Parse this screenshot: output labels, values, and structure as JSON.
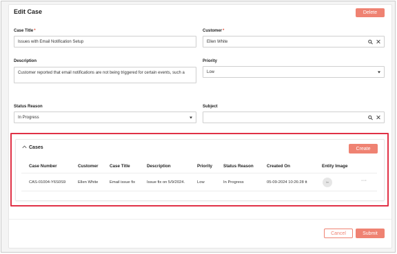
{
  "header": {
    "title": "Edit Case",
    "delete_label": "Delete"
  },
  "form": {
    "case_title": {
      "label": "Case Title",
      "required": "*",
      "value": "Issues with Email Notification Setup"
    },
    "customer": {
      "label": "Customer",
      "required": "*",
      "value": "Ellen White"
    },
    "description": {
      "label": "Description",
      "value": "Customer reported that email notifications are not being triggered for certain events, such a"
    },
    "priority": {
      "label": "Priority",
      "value": "Low"
    },
    "status_reason": {
      "label": "Status Reason",
      "value": "In Progress"
    },
    "subject": {
      "label": "Subject",
      "value": ""
    }
  },
  "cases_panel": {
    "title": "Cases",
    "create_label": "Create",
    "columns": [
      "Case Number",
      "Customer",
      "Case Title",
      "Description",
      "Priority",
      "Status Reason",
      "Created On",
      "Entity Image"
    ],
    "rows": [
      {
        "case_number": "CAS-01004-Y6S0S9",
        "customer": "Ellen White",
        "case_title": "Email issue fix",
        "description": "Issue fix on 5/9/2024.",
        "priority": "Low",
        "status_reason": "In Progress",
        "created_on": "05-09-2024 10:26:28 tt",
        "entity_image": "Im"
      }
    ],
    "more_label": "···"
  },
  "footer": {
    "cancel_label": "Cancel",
    "submit_label": "Submit"
  },
  "icons": {
    "search": "search-icon",
    "clear": "close-icon",
    "dropdown": "chevron-down-icon",
    "collapse": "chevron-up-icon"
  },
  "colors": {
    "accent": "#ef8272",
    "highlight": "#e03045"
  }
}
